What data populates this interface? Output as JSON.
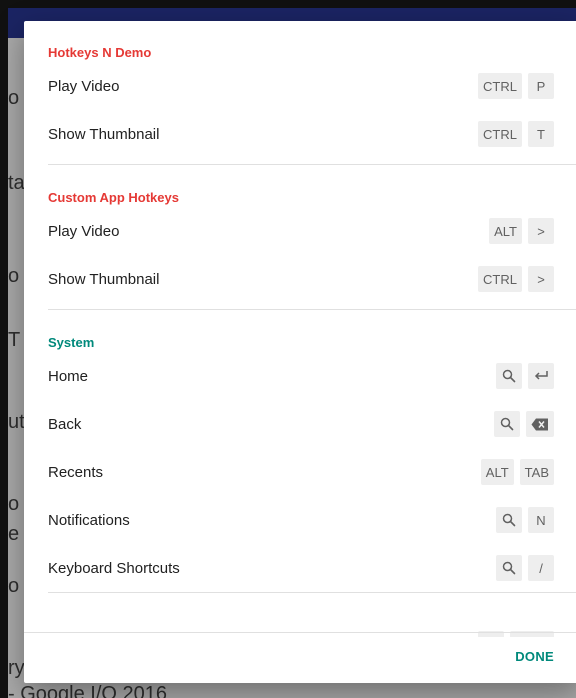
{
  "background": {
    "fragments": [
      "o",
      "ta",
      "o",
      "T",
      "ut",
      "o",
      "e",
      "o"
    ],
    "bottom_fragment_top": "ry",
    "bottom_fragment_bottom": "- Google I/O 2016"
  },
  "dialog": {
    "groups": [
      {
        "title": "Hotkeys N Demo",
        "color": "#e53935",
        "items": [
          {
            "label": "Play Video",
            "keys": [
              {
                "type": "text",
                "value": "CTRL"
              },
              {
                "type": "text",
                "value": "P"
              }
            ]
          },
          {
            "label": "Show Thumbnail",
            "keys": [
              {
                "type": "text",
                "value": "CTRL"
              },
              {
                "type": "text",
                "value": "T"
              }
            ]
          }
        ]
      },
      {
        "title": "Custom App Hotkeys",
        "color": "#e53935",
        "items": [
          {
            "label": "Play Video",
            "keys": [
              {
                "type": "text",
                "value": "ALT"
              },
              {
                "type": "text",
                "value": ">"
              }
            ]
          },
          {
            "label": "Show Thumbnail",
            "keys": [
              {
                "type": "text",
                "value": "CTRL"
              },
              {
                "type": "text",
                "value": ">"
              }
            ]
          }
        ]
      },
      {
        "title": "System",
        "color": "#00897b",
        "items": [
          {
            "label": "Home",
            "keys": [
              {
                "type": "icon",
                "value": "search-icon"
              },
              {
                "type": "icon",
                "value": "enter-icon"
              }
            ]
          },
          {
            "label": "Back",
            "keys": [
              {
                "type": "icon",
                "value": "search-icon"
              },
              {
                "type": "icon",
                "value": "backspace-icon"
              }
            ]
          },
          {
            "label": "Recents",
            "keys": [
              {
                "type": "text",
                "value": "ALT"
              },
              {
                "type": "text",
                "value": "TAB"
              }
            ]
          },
          {
            "label": "Notifications",
            "keys": [
              {
                "type": "icon",
                "value": "search-icon"
              },
              {
                "type": "text",
                "value": "N"
              }
            ]
          },
          {
            "label": "Keyboard Shortcuts",
            "keys": [
              {
                "type": "icon",
                "value": "search-icon"
              },
              {
                "type": "text",
                "value": "/"
              }
            ]
          }
        ]
      }
    ],
    "done_label": "DONE",
    "accent": "#00897b",
    "app_accent": "#e53935"
  }
}
